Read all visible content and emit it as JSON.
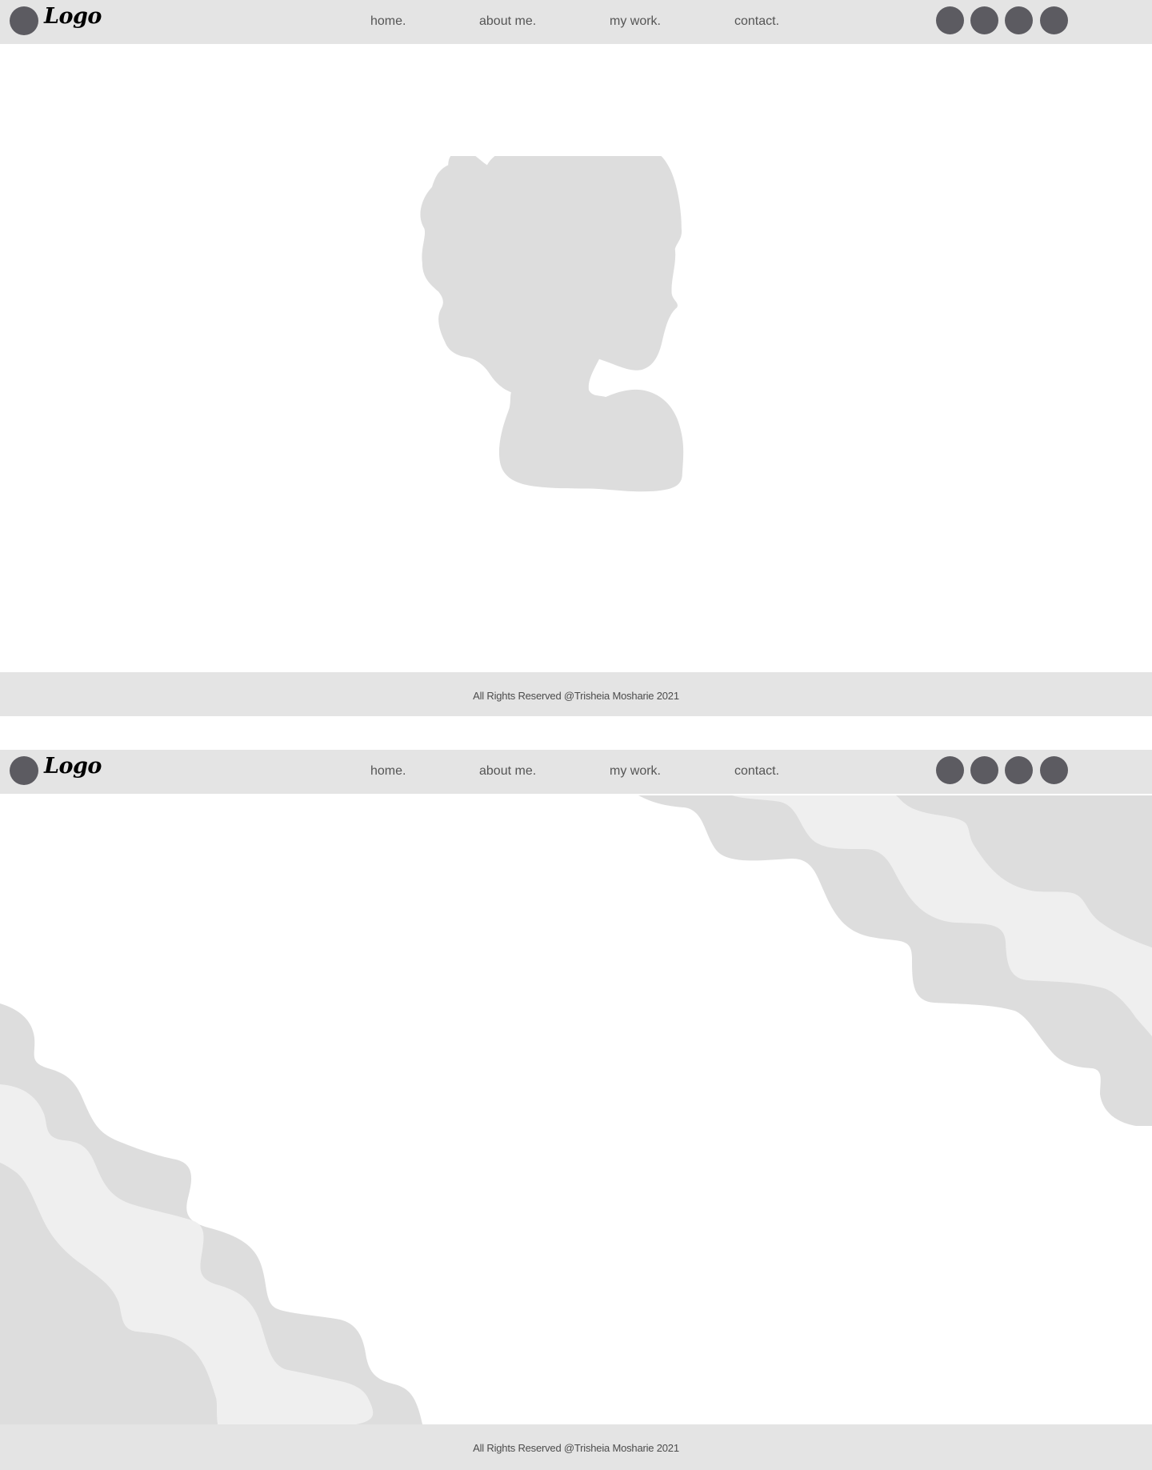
{
  "header": {
    "logo_text": "Logo",
    "nav_links": [
      {
        "label": "home."
      },
      {
        "label": "about me."
      },
      {
        "label": "my work."
      },
      {
        "label": "contact."
      }
    ]
  },
  "footer": {
    "text": "All Rights Reserved @Trisheia Mosharie 2021"
  },
  "colors": {
    "header_bg": "#e4e4e4",
    "icon_fill": "#5c5b61",
    "placeholder_gray": "#dddddd",
    "light_gray": "#efefef",
    "page_bg": "#ffffff"
  }
}
